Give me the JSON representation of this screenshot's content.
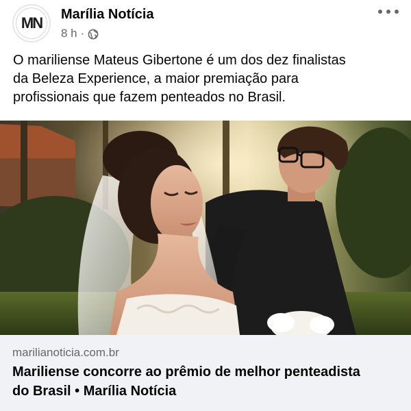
{
  "header": {
    "avatar_initials": "MN",
    "page_name": "Marília Notícia",
    "time": "8 h",
    "separator": "·",
    "audience_icon": "globe-icon",
    "more_icon": "more-options-icon"
  },
  "post": {
    "text_lines": [
      "O mariliense Mateus Gibertone é um dos dez finalistas",
      "da Beleza Experience, a maior premiação para",
      "profissionais que fazem penteados no Brasil."
    ]
  },
  "link_preview": {
    "domain": "marilianoticia.com.br",
    "title_lines": [
      "Mariliense concorre ao prêmio de melhor penteadista",
      "do Brasil • Marília Notícia"
    ]
  },
  "colors": {
    "text_primary": "#050505",
    "text_secondary": "#65676b",
    "link_preview_bg": "#f0f2f5"
  }
}
